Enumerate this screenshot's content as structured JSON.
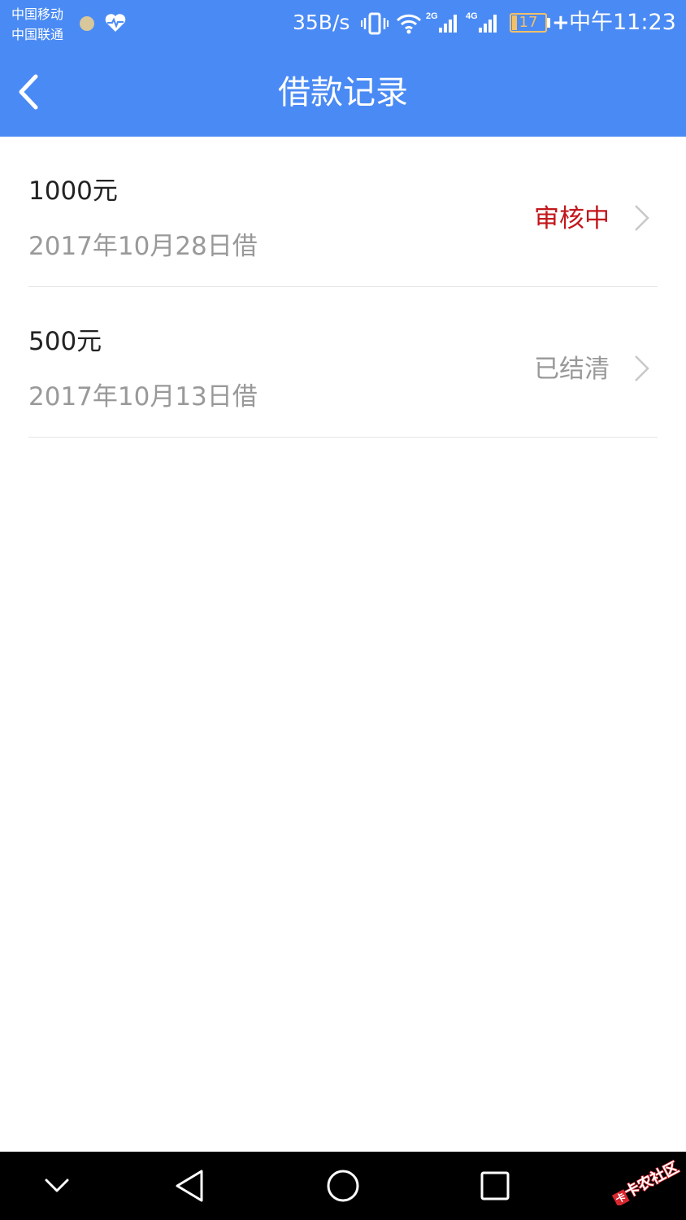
{
  "status_bar": {
    "carrier_1": "中国移动",
    "carrier_2": "中国联通",
    "net_speed": "35B/s",
    "signal_1_label": "2G",
    "signal_2_label": "4G",
    "battery_level": "17",
    "time": "中午11:23",
    "icons": [
      "heart-rate-icon",
      "vibrate-icon",
      "wifi-icon",
      "signal-icon",
      "battery-icon"
    ]
  },
  "nav": {
    "title": "借款记录",
    "back_icon": "chevron-left-icon"
  },
  "records": [
    {
      "amount": "1000元",
      "date": "2017年10月28日借",
      "status": "审核中",
      "status_color": "#c2161b"
    },
    {
      "amount": "500元",
      "date": "2017年10月13日借",
      "status": "已结清",
      "status_color": "#999999"
    }
  ],
  "system_nav": {
    "buttons": [
      "hide-keyboard-icon",
      "back-triangle-icon",
      "home-circle-icon",
      "recents-square-icon"
    ]
  },
  "watermark": "卡农社区",
  "colors": {
    "header": "#4a8af4",
    "pending": "#c2161b",
    "muted": "#999999"
  }
}
